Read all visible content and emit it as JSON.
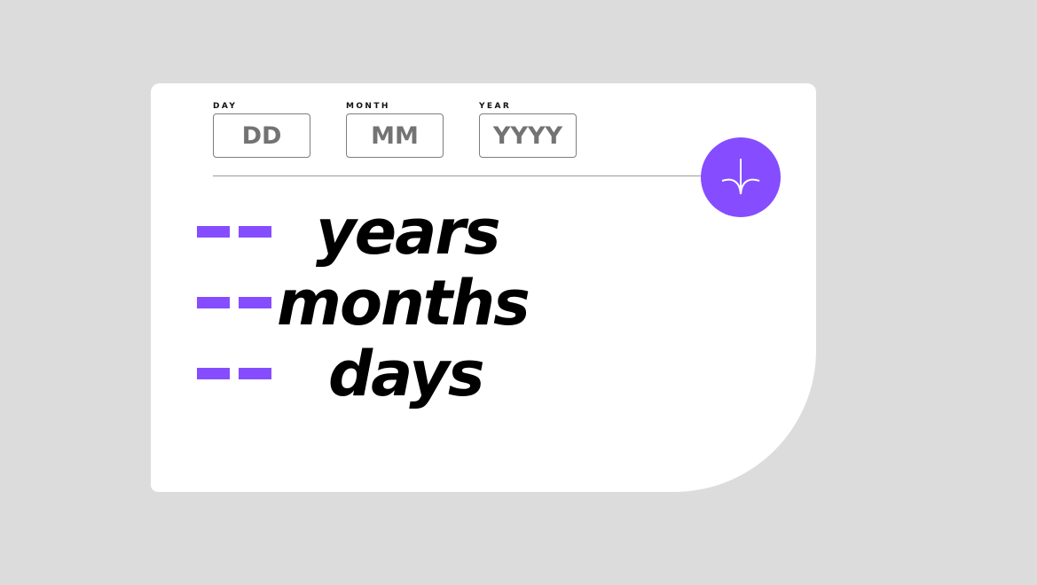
{
  "form": {
    "day_label": "DAY",
    "day_placeholder": "DD",
    "month_label": "MONTH",
    "month_placeholder": "MM",
    "year_label": "YEAR",
    "year_placeholder": "YYYY",
    "submit_icon": "arrow-down-icon"
  },
  "results": {
    "years_value": "--",
    "years_label": "years",
    "months_value": "--",
    "months_label": "months",
    "days_value": "--",
    "days_label": "days"
  },
  "colors": {
    "accent": "#854dff",
    "background": "#dcdcdc",
    "card": "#ffffff",
    "text": "#000000",
    "placeholder": "#737373"
  }
}
